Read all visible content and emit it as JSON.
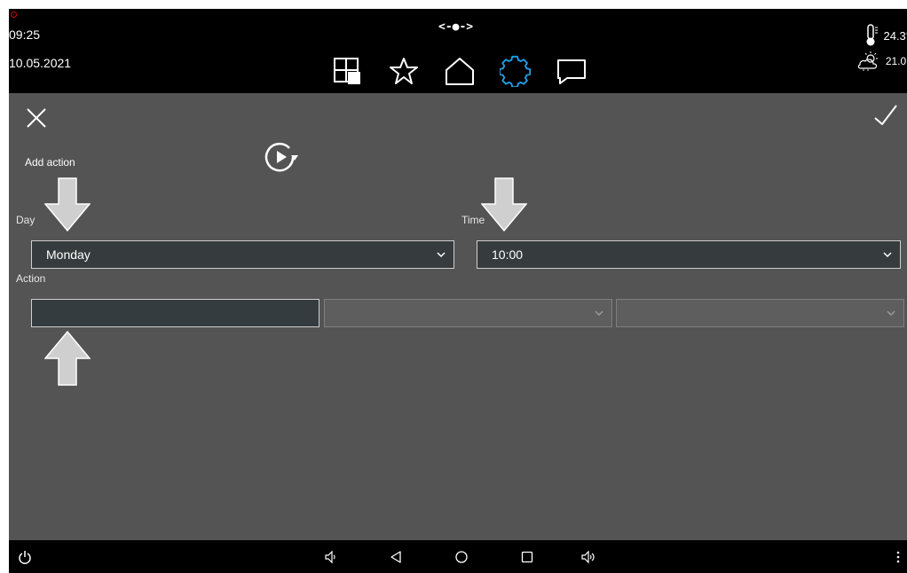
{
  "status": {
    "time": "09:25",
    "date": "10.05.2021",
    "connection": "<-●->",
    "temperature": "24.3°",
    "weather_temperature": "21.0°"
  },
  "nav": {
    "items": [
      {
        "name": "rooms-grid-icon"
      },
      {
        "name": "favorites-star-icon"
      },
      {
        "name": "home-icon"
      },
      {
        "name": "settings-gear-icon",
        "active": true
      },
      {
        "name": "messages-chat-icon"
      }
    ],
    "active_color": "#1e9ee6"
  },
  "form": {
    "title": "Add action",
    "day_label": "Day",
    "time_label": "Time",
    "action_label": "Action",
    "day_value": "Monday",
    "time_value": "10:00",
    "action_value": ""
  },
  "bottom": {
    "icons": [
      "power-icon",
      "volume-down-icon",
      "back-icon",
      "home-circle-icon",
      "recent-apps-icon",
      "volume-up-icon",
      "more-menu-icon"
    ]
  }
}
